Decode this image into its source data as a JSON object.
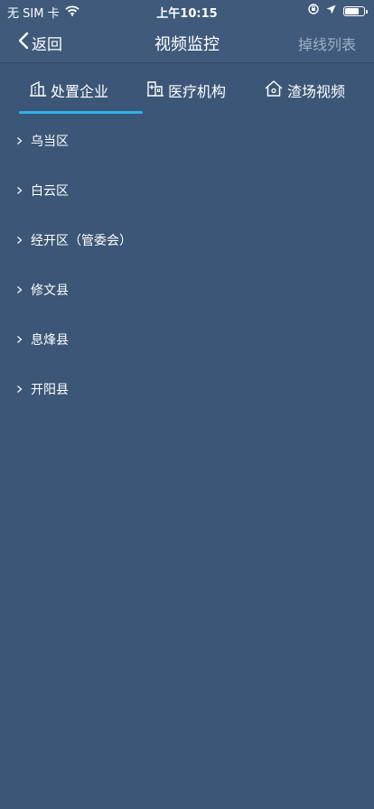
{
  "status_bar": {
    "carrier": "无 SIM 卡",
    "time": "上午10:15"
  },
  "nav": {
    "back_label": "返回",
    "title": "视频监控",
    "right_label": "掉线列表"
  },
  "tabs": [
    {
      "label": "处置企业",
      "icon": "building-icon",
      "active": true
    },
    {
      "label": "医疗机构",
      "icon": "hospital-icon",
      "active": false
    },
    {
      "label": "渣场视频",
      "icon": "house-icon",
      "active": false
    }
  ],
  "districts": [
    {
      "label": "乌当区"
    },
    {
      "label": "白云区"
    },
    {
      "label": "经开区（管委会）"
    },
    {
      "label": "修文县"
    },
    {
      "label": "息烽县"
    },
    {
      "label": "开阳县"
    }
  ],
  "colors": {
    "background": "#3b5677",
    "nav_background": "#3f5a7b",
    "accent": "#2fb3ea",
    "muted_text": "#9fb0c5"
  }
}
